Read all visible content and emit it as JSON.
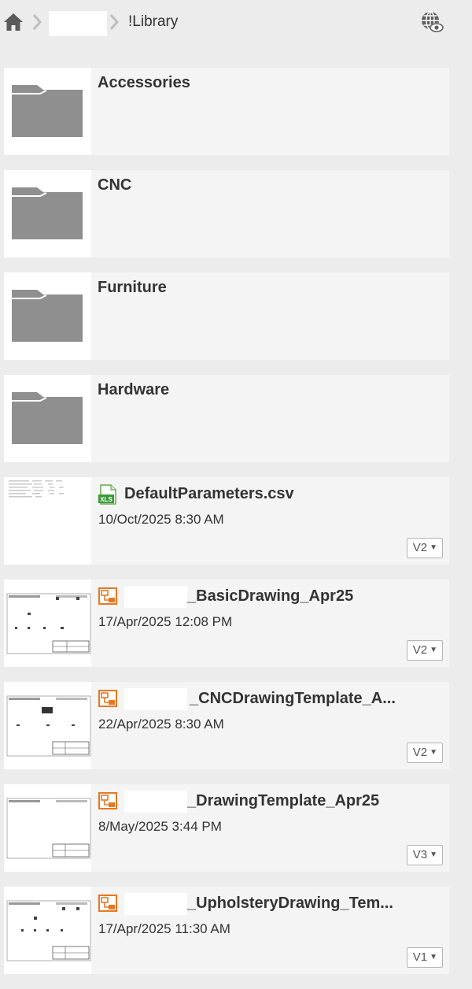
{
  "breadcrumb": {
    "home_icon": "home-icon",
    "separator_icon": "chevron-right-icon",
    "current": "!Library"
  },
  "toolbar": {
    "globe_icon": "globe-eye-icon"
  },
  "folders": [
    {
      "name": "Accessories",
      "icon": "folder-icon"
    },
    {
      "name": "CNC",
      "icon": "folder-icon"
    },
    {
      "name": "Furniture",
      "icon": "folder-icon"
    },
    {
      "name": "Hardware",
      "icon": "folder-icon"
    }
  ],
  "files": [
    {
      "name": "DefaultParameters.csv",
      "date": "10/Oct/2025 8:30 AM",
      "version": "V2",
      "icon": "xls-file-icon"
    },
    {
      "name": "_BasicDrawing_Apr25",
      "date": "17/Apr/2025 12:08 PM",
      "version": "V2",
      "icon": "drawing-file-icon"
    },
    {
      "name": "_CNCDrawingTemplate_A...",
      "date": "22/Apr/2025 8:30 AM",
      "version": "V2",
      "icon": "drawing-file-icon"
    },
    {
      "name": "_DrawingTemplate_Apr25",
      "date": "8/May/2025 3:44 PM",
      "version": "V3",
      "icon": "drawing-file-icon"
    },
    {
      "name": "_UpholsteryDrawing_Tem...",
      "date": "17/Apr/2025 11:30 AM",
      "version": "V1",
      "icon": "drawing-file-icon"
    }
  ],
  "colors": {
    "folder": "#8f8f8f",
    "xls_green": "#3a9a3a",
    "drawing_orange": "#e87722",
    "row_bg": "#f4f4f4",
    "page_bg": "#ececec"
  }
}
